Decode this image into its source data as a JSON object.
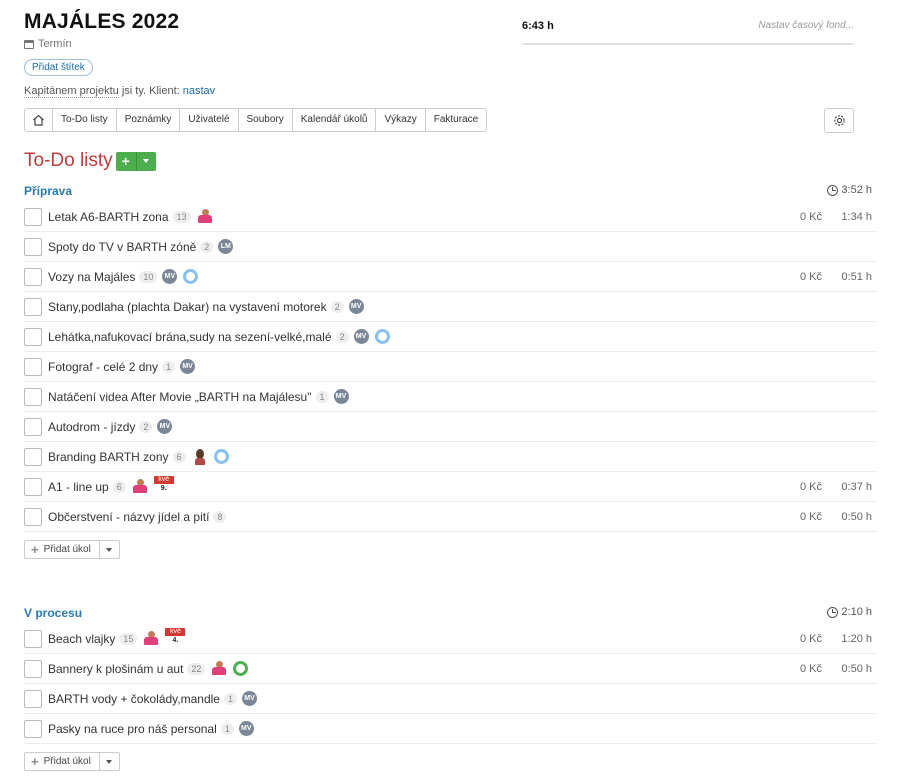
{
  "project": {
    "title": "MAJÁLES 2022",
    "term_label": "Termín",
    "add_tag": "Přidat štítek",
    "captain_text": "Kapitánem projektu",
    "captain_rest": " jsi ty. Klient: ",
    "client_link": "nastav"
  },
  "time": {
    "value": "6:43 h",
    "placeholder": "Nastav časový fond..."
  },
  "nav": {
    "tabs": [
      "To-Do listy",
      "Poznámky",
      "Uživatelé",
      "Soubory",
      "Kalendář úkolů",
      "Výkazy",
      "Fakturace"
    ]
  },
  "heading": "To-Do listy",
  "add_task_label": "Přidat úkol",
  "sections": [
    {
      "title": "Příprava",
      "time": "3:52 h",
      "tasks": [
        {
          "name": "Letak A6-BARTH zona",
          "count": "13",
          "extras": [
            {
              "type": "person"
            }
          ],
          "price": "0 Kč",
          "duration": "1:34 h"
        },
        {
          "name": "Spoty do TV v BARTH zóně",
          "count": "2",
          "extras": [
            {
              "type": "initials",
              "text": "LM"
            }
          ],
          "price": "",
          "duration": ""
        },
        {
          "name": "Vozy na Majáles",
          "count": "10",
          "extras": [
            {
              "type": "initials",
              "text": "MV"
            },
            {
              "type": "ring"
            }
          ],
          "price": "0 Kč",
          "duration": "0:51 h"
        },
        {
          "name": "Stany,podlaha (plachta Dakar) na vystavení motorek",
          "count": "2",
          "extras": [
            {
              "type": "initials",
              "text": "MV"
            }
          ],
          "price": "",
          "duration": ""
        },
        {
          "name": "Lehátka,nafukovací brána,sudy na sezení-velké,malé",
          "count": "2",
          "extras": [
            {
              "type": "initials",
              "text": "MV"
            },
            {
              "type": "ring"
            }
          ],
          "price": "",
          "duration": ""
        },
        {
          "name": "Fotograf - celé 2 dny",
          "count": "1",
          "extras": [
            {
              "type": "initials",
              "text": "MV"
            }
          ],
          "price": "",
          "duration": ""
        },
        {
          "name": "Natáčení videa After Movie „BARTH na Majálesu\"",
          "count": "1",
          "extras": [
            {
              "type": "initials",
              "text": "MV"
            }
          ],
          "price": "",
          "duration": ""
        },
        {
          "name": "Autodrom - jízdy",
          "count": "2",
          "extras": [
            {
              "type": "initials",
              "text": "MV"
            }
          ],
          "price": "",
          "duration": ""
        },
        {
          "name": "Branding BARTH zony",
          "count": "6",
          "extras": [
            {
              "type": "woman"
            },
            {
              "type": "ring"
            }
          ],
          "price": "",
          "duration": ""
        },
        {
          "name": "A1 - line up",
          "count": "6",
          "extras": [
            {
              "type": "person"
            },
            {
              "type": "cal",
              "month": "kvě",
              "day": "9."
            }
          ],
          "price": "0 Kč",
          "duration": "0:37 h"
        },
        {
          "name": "Občerstvení - názvy jídel a pití",
          "count": "8",
          "extras": [],
          "price": "0 Kč",
          "duration": "0:50 h"
        }
      ]
    },
    {
      "title": "V procesu",
      "time": "2:10 h",
      "tasks": [
        {
          "name": "Beach vlajky",
          "count": "15",
          "extras": [
            {
              "type": "person"
            },
            {
              "type": "cal",
              "month": "kvě",
              "day": "4."
            }
          ],
          "price": "0 Kč",
          "duration": "1:20 h"
        },
        {
          "name": "Bannery k plošinám u aut",
          "count": "22",
          "extras": [
            {
              "type": "person"
            },
            {
              "type": "ring",
              "color": "#4cb050"
            }
          ],
          "price": "0 Kč",
          "duration": "0:50 h"
        },
        {
          "name": "BARTH vody + čokolády,mandle",
          "count": "1",
          "extras": [
            {
              "type": "initials",
              "text": "MV"
            }
          ],
          "price": "",
          "duration": ""
        },
        {
          "name": "Pasky na ruce pro náš personal",
          "count": "1",
          "extras": [
            {
              "type": "initials",
              "text": "MV"
            }
          ],
          "price": "",
          "duration": ""
        }
      ]
    }
  ]
}
